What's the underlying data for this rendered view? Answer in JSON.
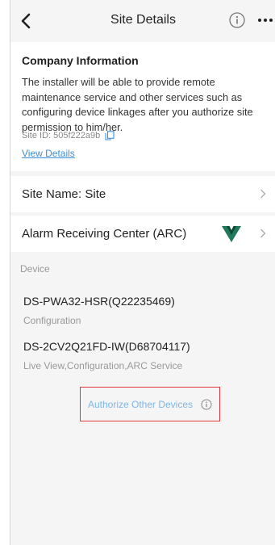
{
  "header": {
    "title": "Site Details"
  },
  "company": {
    "heading": "Company Information",
    "description": "The installer will be able to provide remote maintenance service and other services such as configuring device linkages after you authorize site permission to him/her.",
    "site_id": "Site ID: 505f222a9b",
    "view_details": "View Details"
  },
  "rows": [
    {
      "label": "Site Name: Site"
    },
    {
      "label": "Alarm Receiving Center (ARC)"
    }
  ],
  "device_section": {
    "label": "Device"
  },
  "devices": [
    {
      "name": "DS-PWA32-HSR(Q22235469)",
      "services": "Configuration"
    },
    {
      "name": "DS-2CV2Q21FD-IW(D68704117)",
      "services": "Live View,Configuration,ARC Service"
    }
  ],
  "authorize": {
    "label": "Authorize Other Devices"
  },
  "colors": {
    "link": "#3b8fd8",
    "highlight_border": "#e0383e",
    "arc_logo": "#1f7a5a"
  }
}
